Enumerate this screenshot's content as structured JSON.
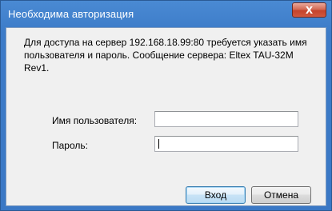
{
  "window": {
    "title": "Необходима авторизация",
    "close_glyph": "X"
  },
  "dialog": {
    "message": "Для доступа на сервер 192.168.18.99:80 требуется указать имя пользователя и пароль. Сообщение сервера: Eltex TAU-32M Rev1.",
    "username_label": "Имя пользователя:",
    "username_value": "",
    "password_label": "Пароль:",
    "password_value": ""
  },
  "buttons": {
    "ok_label": "Вход",
    "cancel_label": "Отмена"
  },
  "colors": {
    "titlebar": "#3c7bc8",
    "client_bg": "#f0f0f0",
    "close_button": "#c4432c"
  }
}
